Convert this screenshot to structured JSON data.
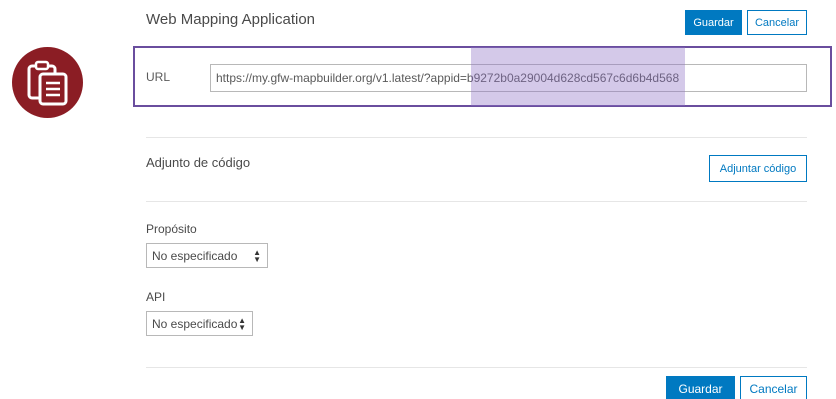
{
  "header": {
    "title": "Web Mapping Application",
    "save_label": "Guardar",
    "cancel_label": "Cancelar"
  },
  "url_field": {
    "label": "URL",
    "value": "https://my.gfw-mapbuilder.org/v1.latest/?appid=b9272b0a29004d628cd567c6d6b4d568"
  },
  "code_attachment": {
    "title": "Adjunto de código",
    "button_label": "Adjuntar código"
  },
  "purpose": {
    "label": "Propósito",
    "selected": "No especificado"
  },
  "api": {
    "label": "API",
    "selected": "No especificado"
  },
  "footer": {
    "save_label": "Guardar",
    "cancel_label": "Cancelar"
  },
  "colors": {
    "primary": "#0079c1",
    "badge": "#8b1d24",
    "highlight_border": "#6a4e9e",
    "selection": "#8e70c4"
  }
}
